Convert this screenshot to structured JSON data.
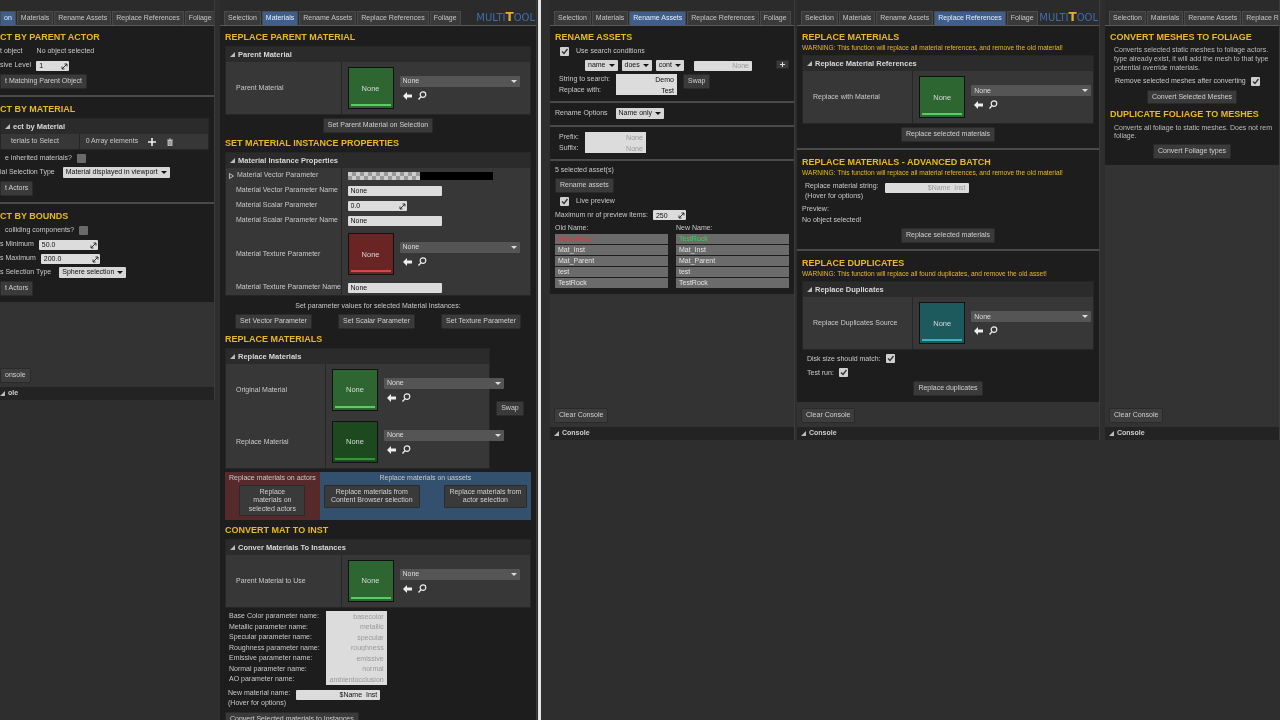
{
  "panels": [
    {
      "tabs": [
        {
          "label": "on",
          "selected": true
        },
        {
          "label": "Materials",
          "selected": false
        },
        {
          "label": "Rename Assets",
          "selected": false
        },
        {
          "label": "Replace References",
          "selected": false
        },
        {
          "label": "Foliage",
          "selected": false
        }
      ],
      "rows": [
        {
          "kind": "heading",
          "text": "CT BY PARENT ACTOR"
        },
        {
          "kind": "info",
          "label": "t object",
          "value": "No object selected"
        },
        {
          "kind": "field",
          "label": "sive Level",
          "value": "1",
          "spinner": true
        },
        {
          "kind": "action",
          "label": "t Matching Parent Object"
        },
        {
          "kind": "divider"
        },
        {
          "kind": "heading",
          "text": "CT BY MATERIAL"
        },
        {
          "kind": "group",
          "title": "ect by Material",
          "items": [
            {
              "kind": "array",
              "label": "terials to Select",
              "value": "0 Array elements"
            }
          ]
        },
        {
          "kind": "option",
          "label": "e inherited materials?",
          "checked": false
        },
        {
          "kind": "dropdown",
          "label": "ial Selection Type",
          "value": "Material displayed in viewport"
        },
        {
          "kind": "action",
          "label": "t Actors"
        },
        {
          "kind": "divider"
        },
        {
          "kind": "heading",
          "text": "CT BY BOUNDS"
        },
        {
          "kind": "option",
          "label": "colliding components?",
          "checked": false
        },
        {
          "kind": "field",
          "label": "s Minimum",
          "value": "50.0",
          "spinner": true
        },
        {
          "kind": "field",
          "label": "s Maximum",
          "value": "200.0",
          "spinner": true
        },
        {
          "kind": "dropdown",
          "label": "s Selection Type",
          "value": "Sphere selection"
        },
        {
          "kind": "action",
          "label": "t Actors"
        }
      ],
      "console": {
        "clear": "onsole",
        "title": "ole"
      }
    },
    {
      "tabs": [
        {
          "label": "Selection",
          "selected": false
        },
        {
          "label": "Materials",
          "selected": true
        },
        {
          "label": "Rename Assets",
          "selected": false
        },
        {
          "label": "Replace References",
          "selected": false
        },
        {
          "label": "Foliage",
          "selected": false
        }
      ],
      "logo": [
        "MULTI",
        "T",
        "OOL"
      ],
      "rows": [
        {
          "kind": "heading",
          "text": "REPLACE PARENT MATERIAL"
        },
        {
          "kind": "group",
          "title": "Parent Material",
          "items": [
            {
              "kind": "asset",
              "label": "Parent Material",
              "thumb": "None",
              "value": "None",
              "color": "#2d6630"
            }
          ]
        },
        {
          "kind": "button",
          "label": "Set Parent Material on Selection"
        },
        {
          "kind": "heading",
          "text": "SET MATERIAL INSTANCE PROPERTIES"
        },
        {
          "kind": "group",
          "title": "Material Instance Properties",
          "items": [
            {
              "kind": "swatch",
              "label": "Material Vector Parameter",
              "expanded": false
            },
            {
              "kind": "field",
              "label": "Material Vector Parameter Name",
              "value": "None"
            },
            {
              "kind": "field",
              "label": "Material Scalar Parameter",
              "value": "0.0",
              "spinner": true
            },
            {
              "kind": "field",
              "label": "Material Scalar Parameter Name",
              "value": "None"
            },
            {
              "kind": "asset",
              "label": "Material Texture Parameter",
              "thumb": "None",
              "value": "None",
              "color": "#6a2424"
            },
            {
              "kind": "field",
              "label": "Material Texture Parameter Name",
              "value": "None"
            }
          ]
        },
        {
          "kind": "note",
          "text": "Set parameter values for selected Material Instances:"
        },
        {
          "kind": "buttons",
          "labels": [
            "Set Vector Parameter",
            "Set Scalar Parameter",
            "Set Texture Parameter"
          ]
        },
        {
          "kind": "heading",
          "text": "REPLACE MATERIALS"
        },
        {
          "kind": "group",
          "title": "Replace Materials",
          "side_button": "Swap",
          "items": [
            {
              "kind": "asset",
              "label": "Original Material",
              "thumb": "None",
              "value": "None",
              "color": "#2d6630"
            },
            {
              "kind": "asset",
              "label": "Replace Material",
              "thumb": "None",
              "value": "None",
              "color": "#1c4a1e"
            }
          ]
        },
        {
          "kind": "split",
          "sections": [
            {
              "title": "Replace materials on actors",
              "color": "#562a2a",
              "buttons": [
                "Replace materials on selected actors"
              ]
            },
            {
              "title": "Replace materials on uassets",
              "color": "#33506f",
              "buttons": [
                "Replace materials from Content Browser selection",
                "Replace materials from actor selection"
              ]
            }
          ]
        },
        {
          "kind": "heading",
          "text": "CONVERT MAT TO INST"
        },
        {
          "kind": "group",
          "title": "Conver Materials To Instances",
          "items": [
            {
              "kind": "asset",
              "label": "Parent Material to Use",
              "thumb": "None",
              "value": "None",
              "color": "#2d6630"
            }
          ]
        },
        {
          "kind": "stack",
          "fields": [
            {
              "label": "Base Color parameter name:",
              "placeholder": "basecolor"
            },
            {
              "label": "Metallic parameter name:",
              "placeholder": "metallic"
            },
            {
              "label": "Specular parameter name:",
              "placeholder": "specular"
            },
            {
              "label": "Roughness parameter name:",
              "placeholder": "roughness"
            },
            {
              "label": "Emissive parameter name:",
              "placeholder": "emissive"
            },
            {
              "label": "Normal parameter name:",
              "placeholder": "normal"
            },
            {
              "label": "AO parameter name:",
              "placeholder": "ambientocclusion"
            }
          ]
        },
        {
          "kind": "namefield",
          "lines": [
            "New material name:",
            "(Hover for options)"
          ],
          "value": "$Name_Inst"
        },
        {
          "kind": "action",
          "label": "Convert Selected materials to Instances"
        }
      ]
    },
    {
      "tabs": [
        {
          "label": "Selection",
          "selected": false
        },
        {
          "label": "Materials",
          "selected": false
        },
        {
          "label": "Rename Assets",
          "selected": true
        },
        {
          "label": "Replace References",
          "selected": false
        },
        {
          "label": "Foliage",
          "selected": false
        }
      ],
      "rows": [
        {
          "kind": "heading",
          "text": "RENAME ASSETS"
        },
        {
          "kind": "checkbox",
          "label": "Use search conditions",
          "checked": true
        },
        {
          "kind": "conditions",
          "selects": [
            "name",
            "does",
            "cont"
          ],
          "placeholder": "None"
        },
        {
          "kind": "stack",
          "fields": [
            {
              "label": "String to search:",
              "value": "Demo"
            },
            {
              "label": "Replace with:",
              "value": "Test"
            }
          ],
          "button": "Swap"
        },
        {
          "kind": "divider"
        },
        {
          "kind": "dropdown",
          "label": "Rename Options",
          "value": "Name only"
        },
        {
          "kind": "divider"
        },
        {
          "kind": "stack",
          "fields": [
            {
              "label": "Prefix:",
              "placeholder": "None"
            },
            {
              "label": "Suffix:",
              "placeholder": "None"
            }
          ]
        },
        {
          "kind": "divider"
        },
        {
          "kind": "text",
          "text": "5  selected asset(s)"
        },
        {
          "kind": "action",
          "label": "Rename assets"
        },
        {
          "kind": "checkbox",
          "label": "Live preview",
          "checked": true
        },
        {
          "kind": "field",
          "label": "Maximum nr of preview items:",
          "value": "250",
          "spinner": true
        },
        {
          "kind": "table",
          "columns": [
            "Old Name:",
            "New Name:"
          ],
          "rows": [
            {
              "old": "DemoRock",
              "new": "TestRock",
              "changed": true
            },
            {
              "old": "Mat_Inst",
              "new": "Mat_Inst",
              "changed": false
            },
            {
              "old": "Mat_Parent",
              "new": "Mat_Parent",
              "changed": false
            },
            {
              "old": "test",
              "new": "test",
              "changed": false
            },
            {
              "old": "TestRock",
              "new": "TestRock",
              "changed": false
            }
          ]
        }
      ],
      "console": {
        "clear": "Clear Console",
        "title": "Console"
      }
    },
    {
      "tabs": [
        {
          "label": "Selection",
          "selected": false
        },
        {
          "label": "Materials",
          "selected": false
        },
        {
          "label": "Rename Assets",
          "selected": false
        },
        {
          "label": "Replace References",
          "selected": true
        },
        {
          "label": "Foliage",
          "selected": false
        }
      ],
      "logo": [
        "MULTI",
        "T",
        "OOL"
      ],
      "rows": [
        {
          "kind": "heading",
          "text": "REPLACE MATERIALS"
        },
        {
          "kind": "warning",
          "text": "WARNING: This function will replace all material references, and remove the old material!"
        },
        {
          "kind": "group",
          "title": "Replace Material References",
          "items": [
            {
              "kind": "asset",
              "label": "Replace with Material",
              "thumb": "None",
              "value": "None",
              "color": "#2d6630"
            }
          ]
        },
        {
          "kind": "button",
          "label": "Replace selected materials"
        },
        {
          "kind": "divider"
        },
        {
          "kind": "heading",
          "text": "REPLACE MATERIALS - ADVANCED BATCH"
        },
        {
          "kind": "warning",
          "text": "WARNING: This function will replace all material references, and remove the old material!"
        },
        {
          "kind": "namefield",
          "lines": [
            "Replace material string:",
            "(Hover for options)"
          ],
          "placeholder": "$Name_Inst"
        },
        {
          "kind": "text",
          "text": "Preview:"
        },
        {
          "kind": "text",
          "text": "No object selected!"
        },
        {
          "kind": "button",
          "label": "Replace selected materials"
        },
        {
          "kind": "divider"
        },
        {
          "kind": "heading",
          "text": "REPLACE DUPLICATES"
        },
        {
          "kind": "warning",
          "text": "WARNING: This function will replace all found duplicates, and remove the old asset!"
        },
        {
          "kind": "group",
          "title": "Replace Duplicates",
          "items": [
            {
              "kind": "asset",
              "label": "Replace Duplicates Source",
              "thumb": "None",
              "value": "None",
              "color": "#1d5a5e"
            }
          ]
        },
        {
          "kind": "option",
          "label": "Disk size should match:",
          "checked": true
        },
        {
          "kind": "option",
          "label": "Test run:",
          "checked": true
        },
        {
          "kind": "button",
          "label": "Replace duplicates"
        }
      ],
      "console": {
        "clear": "Clear Console",
        "title": "Console"
      }
    },
    {
      "tabs": [
        {
          "label": "Selection",
          "selected": false
        },
        {
          "label": "Materials",
          "selected": false
        },
        {
          "label": "Rename Assets",
          "selected": false
        },
        {
          "label": "Replace R",
          "selected": false
        }
      ],
      "rows": [
        {
          "kind": "heading",
          "text": "CONVERT MESHES TO FOLIAGE"
        },
        {
          "kind": "para",
          "lines": [
            "Converts selected static meshes to foliage actors.",
            "type already exist, it will add the mesh to that type",
            "potential override materials."
          ]
        },
        {
          "kind": "option",
          "label": "Remove selected meshes after converting",
          "checked": true
        },
        {
          "kind": "button",
          "label": "Convert Selected Meshes"
        },
        {
          "kind": "heading",
          "text": "DUPLICATE FOLIAGE TO MESHES"
        },
        {
          "kind": "para",
          "lines": [
            "Converts all foliage to static meshes. Does not rem",
            "foliage."
          ]
        },
        {
          "kind": "button",
          "label": "Convert Foliage types"
        }
      ],
      "console": {
        "clear": "Clear Console",
        "title": "Console"
      }
    }
  ]
}
